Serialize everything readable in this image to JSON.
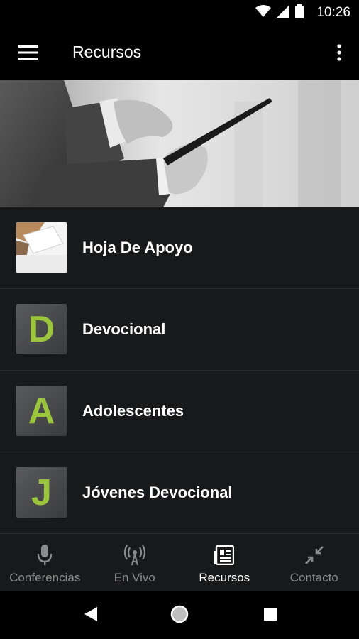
{
  "status_bar": {
    "time": "10:26"
  },
  "app_bar": {
    "title": "Recursos",
    "menu_icon": "hamburger-menu-icon",
    "more_icon": "more-vertical-icon"
  },
  "hero": {
    "description_icon": "hero-banner-image"
  },
  "list": {
    "items": [
      {
        "label": "Hoja De Apoyo",
        "thumb_letter": "",
        "thumb_type": "paper"
      },
      {
        "label": "Devocional",
        "thumb_letter": "D",
        "thumb_type": "letter"
      },
      {
        "label": "Adolescentes",
        "thumb_letter": "A",
        "thumb_type": "letter"
      },
      {
        "label": "Jóvenes Devocional",
        "thumb_letter": "J",
        "thumb_type": "letter"
      }
    ]
  },
  "bottom_nav": {
    "items": [
      {
        "label": "Conferencias",
        "icon": "microphone-icon",
        "active": false
      },
      {
        "label": "En Vivo",
        "icon": "broadcast-icon",
        "active": false
      },
      {
        "label": "Recursos",
        "icon": "newspaper-icon",
        "active": true
      },
      {
        "label": "Contacto",
        "icon": "compress-arrows-icon",
        "active": false
      }
    ]
  },
  "colors": {
    "accent": "#9bc53d",
    "list_bg": "#18191a",
    "inactive": "#8a8b8c"
  }
}
